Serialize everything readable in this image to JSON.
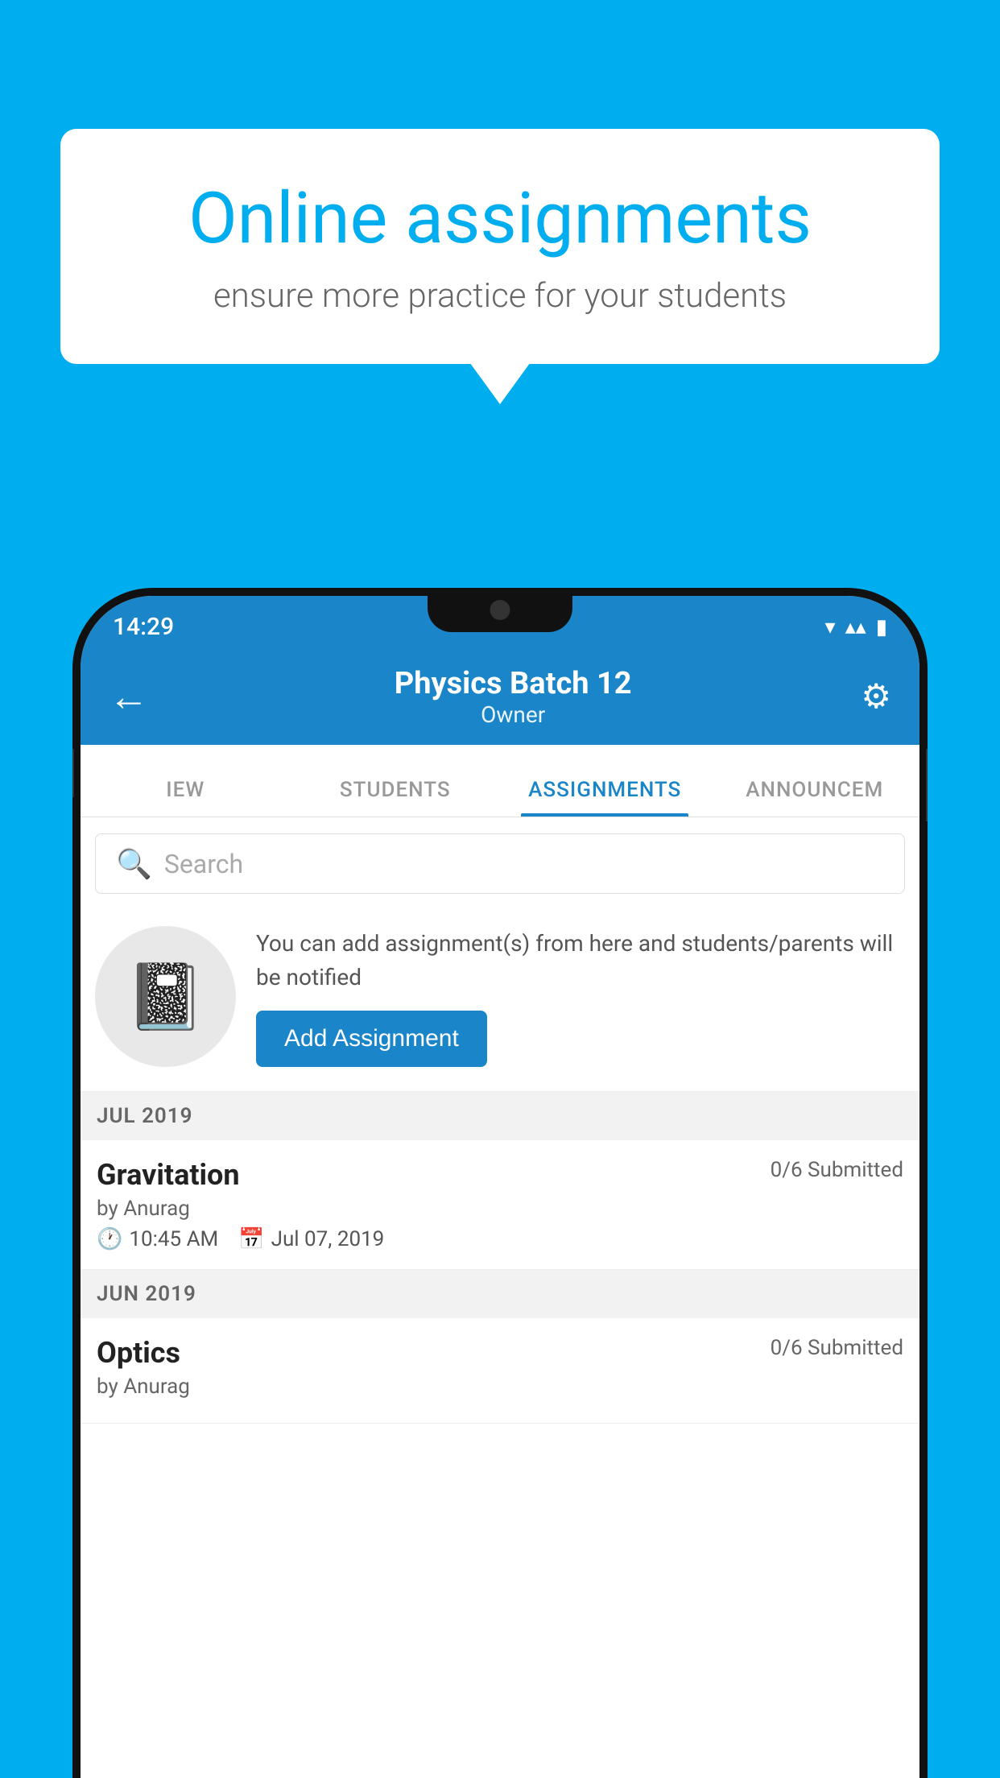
{
  "background_color": "#00AEEF",
  "speech_bubble": {
    "title": "Online assignments",
    "subtitle": "ensure more practice for your students"
  },
  "status_bar": {
    "time": "14:29",
    "icons": "▾◂▮"
  },
  "app_bar": {
    "title": "Physics Batch 12",
    "subtitle": "Owner",
    "back_label": "←",
    "settings_label": "⚙"
  },
  "tabs": [
    {
      "label": "IEW",
      "active": false
    },
    {
      "label": "STUDENTS",
      "active": false
    },
    {
      "label": "ASSIGNMENTS",
      "active": true
    },
    {
      "label": "ANNOUNCEM",
      "active": false
    }
  ],
  "search": {
    "placeholder": "Search"
  },
  "info_card": {
    "description": "You can add assignment(s) from here and students/parents will be notified",
    "button_label": "Add Assignment"
  },
  "sections": [
    {
      "header": "JUL 2019",
      "assignments": [
        {
          "name": "Gravitation",
          "submitted": "0/6 Submitted",
          "author": "by Anurag",
          "time": "10:45 AM",
          "date": "Jul 07, 2019"
        }
      ]
    },
    {
      "header": "JUN 2019",
      "assignments": [
        {
          "name": "Optics",
          "submitted": "0/6 Submitted",
          "author": "by Anurag",
          "time": "",
          "date": ""
        }
      ]
    }
  ]
}
